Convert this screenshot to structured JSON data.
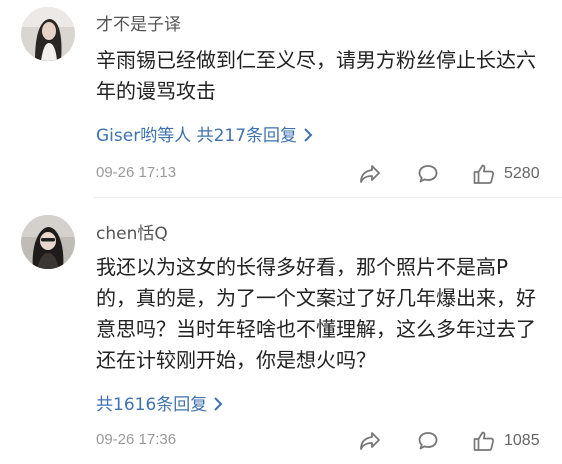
{
  "comments": [
    {
      "username": "才不是子译",
      "text": "辛雨锡已经做到仁至义尽，请男方粉丝停止长达六年的谩骂攻击",
      "replies_label": "Giser哟等人 共217条回复",
      "timestamp": "09-26 17:13",
      "like_count": "5280",
      "avatar_icon": "avatar-photo-icon"
    },
    {
      "username": "chen恬Q",
      "text": "我还以为这女的长得多好看，那个照片不是高P 的，真的是，为了一个文案过了好几年爆出来，好意思吗？当时年轻啥也不懂理解，这么多年过去了还在计较刚开始，你是想火吗？",
      "replies_label": "共1616条回复",
      "timestamp": "09-26 17:36",
      "like_count": "1085",
      "avatar_icon": "avatar-photo-icon"
    }
  ],
  "icons": {
    "share": "share-arrow-icon",
    "comment": "comment-bubble-icon",
    "like": "thumbs-up-icon",
    "chevron": "chevron-right-icon"
  },
  "colors": {
    "link": "#3f72af",
    "meta_gray": "#9a9a9a",
    "text": "#222222"
  }
}
